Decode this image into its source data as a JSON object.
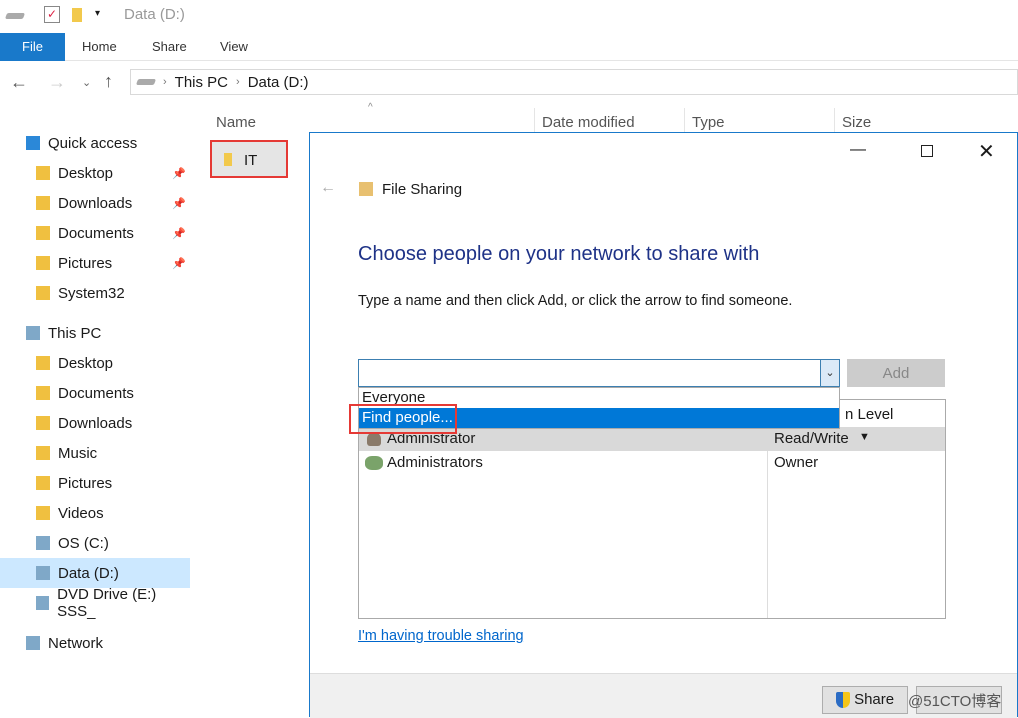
{
  "window": {
    "title": "Data (D:)"
  },
  "ribbon": {
    "tabs": [
      "File",
      "Home",
      "Share",
      "View"
    ]
  },
  "address": {
    "crumbs": [
      "This PC",
      "Data (D:)"
    ]
  },
  "sidebar": {
    "items": [
      {
        "label": "Quick access",
        "icon": "star-icon",
        "pinned": false
      },
      {
        "label": "Desktop",
        "icon": "desktop-folder-icon",
        "pinned": true
      },
      {
        "label": "Downloads",
        "icon": "downloads-folder-icon",
        "pinned": true
      },
      {
        "label": "Documents",
        "icon": "documents-folder-icon",
        "pinned": true
      },
      {
        "label": "Pictures",
        "icon": "pictures-folder-icon",
        "pinned": true
      },
      {
        "label": "System32",
        "icon": "folder-icon",
        "pinned": false
      },
      {
        "label": "This PC",
        "icon": "computer-icon",
        "pinned": false
      },
      {
        "label": "Desktop",
        "icon": "desktop-folder-icon",
        "pinned": false
      },
      {
        "label": "Documents",
        "icon": "documents-folder-icon",
        "pinned": false
      },
      {
        "label": "Downloads",
        "icon": "downloads-folder-icon",
        "pinned": false
      },
      {
        "label": "Music",
        "icon": "music-folder-icon",
        "pinned": false
      },
      {
        "label": "Pictures",
        "icon": "pictures-folder-icon",
        "pinned": false
      },
      {
        "label": "Videos",
        "icon": "videos-folder-icon",
        "pinned": false
      },
      {
        "label": "OS (C:)",
        "icon": "drive-icon",
        "pinned": false
      },
      {
        "label": "Data (D:)",
        "icon": "drive-icon",
        "pinned": false
      },
      {
        "label": "DVD Drive (E:) SSS_",
        "icon": "dvd-icon",
        "pinned": false
      },
      {
        "label": "Network",
        "icon": "network-icon",
        "pinned": false
      }
    ]
  },
  "columns": [
    "Name",
    "Date modified",
    "Type",
    "Size"
  ],
  "files": [
    {
      "name": "IT"
    }
  ],
  "dialog": {
    "title": "File Sharing",
    "heading": "Choose people on your network to share with",
    "instruction": "Type a name and then click Add, or click the arrow to find someone.",
    "add_label": "Add",
    "dropdown": [
      "Everyone",
      "Find people..."
    ],
    "perm_header_partial": "n Level",
    "rows": [
      {
        "name": "Administrator",
        "perm": "Read/Write"
      },
      {
        "name": "Administrators",
        "perm": "Owner"
      }
    ],
    "trouble_link": "I'm having trouble sharing",
    "share_label": "Share"
  },
  "watermark": "@51CTO博客"
}
